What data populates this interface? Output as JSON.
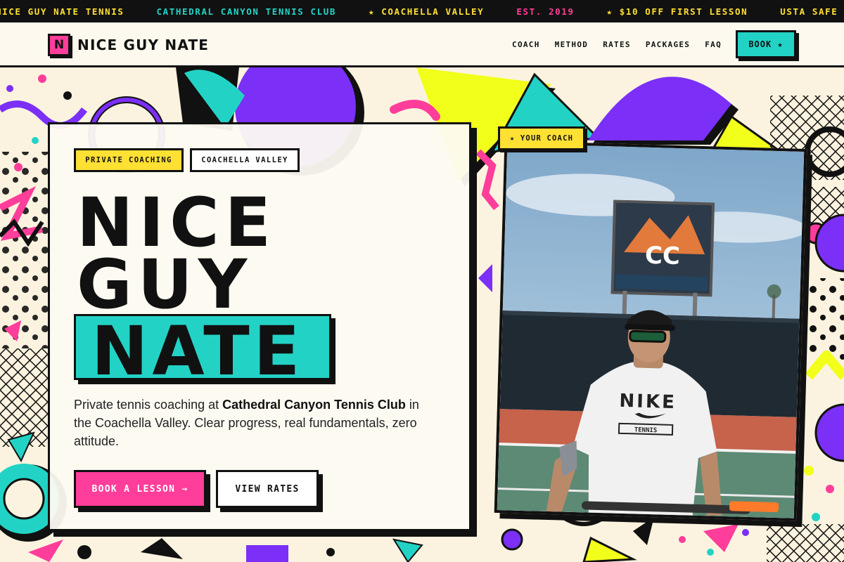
{
  "ticker": {
    "items": [
      {
        "text": "NICE GUY NATE TENNIS",
        "color": "#ffe033"
      },
      {
        "text": "CATHEDRAL CANYON TENNIS CLUB",
        "color": "#22d3c5"
      },
      {
        "text": "★ COACHELLA VALLEY",
        "color": "#ffe033"
      },
      {
        "text": "EST. 2019",
        "color": "#ff3d9a"
      },
      {
        "text": "★ $10 OFF FIRST LESSON",
        "color": "#ffe033"
      },
      {
        "text": "USTA SAFE PLAY",
        "color": "#ffe033"
      }
    ]
  },
  "nav": {
    "logo_letter": "N",
    "logo_text": "NICE GUY NATE",
    "links": [
      "COACH",
      "METHOD",
      "RATES",
      "PACKAGES",
      "FAQ"
    ],
    "book_label": "BOOK ★"
  },
  "hero": {
    "tag_primary": "PRIVATE COACHING",
    "tag_secondary": "COACHELLA VALLEY",
    "title_line1": "NICE",
    "title_line2": "GUY",
    "title_highlight": "NATE",
    "description_pre": "Private tennis coaching at ",
    "description_bold": "Cathedral Canyon Tennis Club",
    "description_post": " in the Coachella Valley. Clear progress, real fundamentals, zero attitude.",
    "cta_primary": "BOOK A LESSON →",
    "cta_secondary": "VIEW RATES",
    "coach_tag": "★ YOUR COACH",
    "photo_shirt_brand": "NIKE",
    "photo_shirt_sub": "TENNIS",
    "photo_sign": "CC"
  },
  "colors": {
    "pink": "#ff3d9a",
    "teal": "#22d3c5",
    "yellow": "#ffe033",
    "purple": "#7b2ff7",
    "cream": "#fbf3df",
    "ink": "#111111"
  }
}
